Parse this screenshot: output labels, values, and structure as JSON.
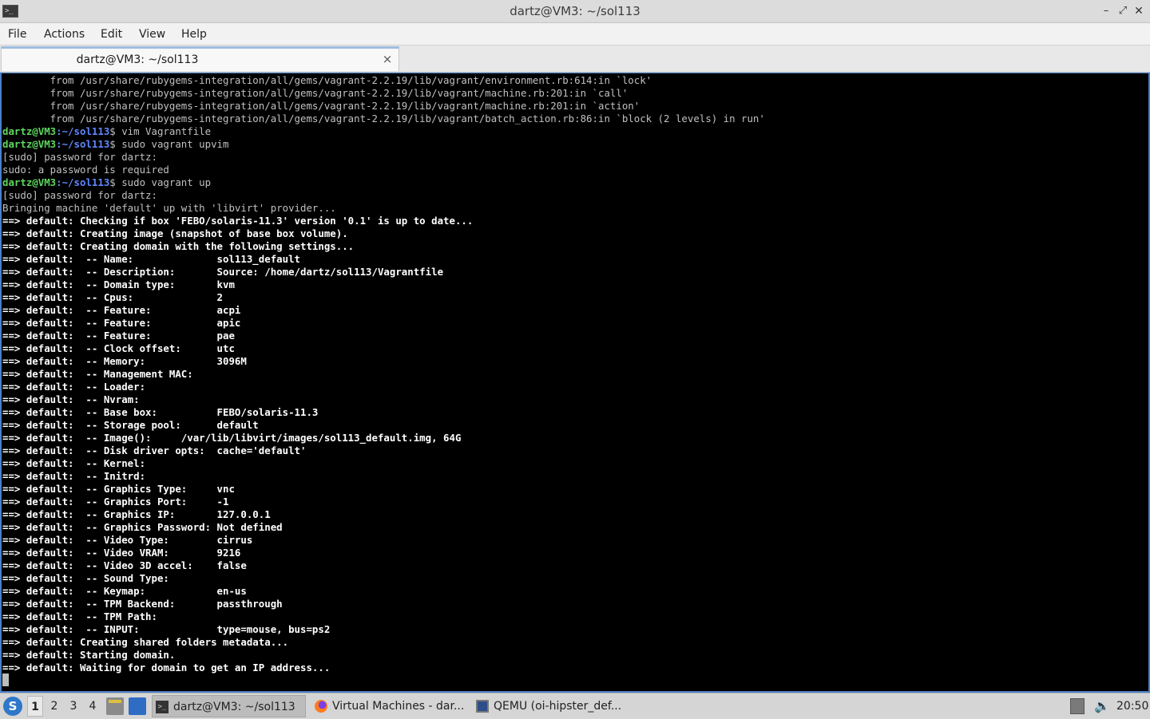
{
  "window": {
    "title": "dartz@VM3: ~/sol113",
    "minimize_glyph": "–",
    "maximize_glyph": "⤢",
    "close_glyph": "✕",
    "app_icon_glyph": ">_"
  },
  "menu": {
    "items": [
      "File",
      "Actions",
      "Edit",
      "View",
      "Help"
    ]
  },
  "tabs": [
    {
      "label": "dartz@VM3: ~/sol113",
      "close_glyph": "×"
    }
  ],
  "terminal": {
    "prompt_user": "dartz@VM3",
    "prompt_path": ":~/sol113",
    "lines": [
      {
        "type": "text",
        "text": "        from /usr/share/rubygems-integration/all/gems/vagrant-2.2.19/lib/vagrant/environment.rb:614:in `lock'"
      },
      {
        "type": "text",
        "text": "        from /usr/share/rubygems-integration/all/gems/vagrant-2.2.19/lib/vagrant/machine.rb:201:in `call'"
      },
      {
        "type": "text",
        "text": "        from /usr/share/rubygems-integration/all/gems/vagrant-2.2.19/lib/vagrant/machine.rb:201:in `action'"
      },
      {
        "type": "text",
        "text": "        from /usr/share/rubygems-integration/all/gems/vagrant-2.2.19/lib/vagrant/batch_action.rb:86:in `block (2 levels) in run'"
      },
      {
        "type": "prompt",
        "text": "$ vim Vagrantfile"
      },
      {
        "type": "prompt",
        "text": "$ sudo vagrant upvim"
      },
      {
        "type": "text",
        "text": "[sudo] password for dartz:"
      },
      {
        "type": "text",
        "text": "sudo: a password is required"
      },
      {
        "type": "prompt",
        "text": "$ sudo vagrant up"
      },
      {
        "type": "text",
        "text": "[sudo] password for dartz:"
      },
      {
        "type": "text",
        "text": "Bringing machine 'default' up with 'libvirt' provider..."
      },
      {
        "type": "arrow",
        "text": "==> default: Checking if box 'FEBO/solaris-11.3' version '0.1' is up to date..."
      },
      {
        "type": "arrow",
        "text": "==> default: Creating image (snapshot of base box volume)."
      },
      {
        "type": "arrow",
        "text": "==> default: Creating domain with the following settings..."
      },
      {
        "type": "arrow",
        "text": "==> default:  -- Name:              sol113_default"
      },
      {
        "type": "arrow",
        "text": "==> default:  -- Description:       Source: /home/dartz/sol113/Vagrantfile"
      },
      {
        "type": "arrow",
        "text": "==> default:  -- Domain type:       kvm"
      },
      {
        "type": "arrow",
        "text": "==> default:  -- Cpus:              2"
      },
      {
        "type": "arrow",
        "text": "==> default:  -- Feature:           acpi"
      },
      {
        "type": "arrow",
        "text": "==> default:  -- Feature:           apic"
      },
      {
        "type": "arrow",
        "text": "==> default:  -- Feature:           pae"
      },
      {
        "type": "arrow",
        "text": "==> default:  -- Clock offset:      utc"
      },
      {
        "type": "arrow",
        "text": "==> default:  -- Memory:            3096M"
      },
      {
        "type": "arrow",
        "text": "==> default:  -- Management MAC:"
      },
      {
        "type": "arrow",
        "text": "==> default:  -- Loader:"
      },
      {
        "type": "arrow",
        "text": "==> default:  -- Nvram:"
      },
      {
        "type": "arrow",
        "text": "==> default:  -- Base box:          FEBO/solaris-11.3"
      },
      {
        "type": "arrow",
        "text": "==> default:  -- Storage pool:      default"
      },
      {
        "type": "arrow",
        "text": "==> default:  -- Image():     /var/lib/libvirt/images/sol113_default.img, 64G"
      },
      {
        "type": "arrow",
        "text": "==> default:  -- Disk driver opts:  cache='default'"
      },
      {
        "type": "arrow",
        "text": "==> default:  -- Kernel:"
      },
      {
        "type": "arrow",
        "text": "==> default:  -- Initrd:"
      },
      {
        "type": "arrow",
        "text": "==> default:  -- Graphics Type:     vnc"
      },
      {
        "type": "arrow",
        "text": "==> default:  -- Graphics Port:     -1"
      },
      {
        "type": "arrow",
        "text": "==> default:  -- Graphics IP:       127.0.0.1"
      },
      {
        "type": "arrow",
        "text": "==> default:  -- Graphics Password: Not defined"
      },
      {
        "type": "arrow",
        "text": "==> default:  -- Video Type:        cirrus"
      },
      {
        "type": "arrow",
        "text": "==> default:  -- Video VRAM:        9216"
      },
      {
        "type": "arrow",
        "text": "==> default:  -- Video 3D accel:    false"
      },
      {
        "type": "arrow",
        "text": "==> default:  -- Sound Type:"
      },
      {
        "type": "arrow",
        "text": "==> default:  -- Keymap:            en-us"
      },
      {
        "type": "arrow",
        "text": "==> default:  -- TPM Backend:       passthrough"
      },
      {
        "type": "arrow",
        "text": "==> default:  -- TPM Path:"
      },
      {
        "type": "arrow",
        "text": "==> default:  -- INPUT:             type=mouse, bus=ps2"
      },
      {
        "type": "arrow",
        "text": "==> default: Creating shared folders metadata..."
      },
      {
        "type": "arrow",
        "text": "==> default: Starting domain."
      },
      {
        "type": "arrow",
        "text": "==> default: Waiting for domain to get an IP address..."
      }
    ]
  },
  "taskbar": {
    "start_glyph": "S",
    "workspaces": [
      "1",
      "2",
      "3",
      "4"
    ],
    "active_workspace": "1",
    "tasks": [
      {
        "label": "dartz@VM3: ~/sol113",
        "icon": "terminal-icon",
        "active": true
      },
      {
        "label": "Virtual Machines - dar...",
        "icon": "firefox-icon",
        "active": false
      },
      {
        "label": "QEMU (oi-hipster_def...",
        "icon": "qemu-icon",
        "active": false
      }
    ],
    "volume_glyph": "🔈",
    "clock": "20:50"
  }
}
